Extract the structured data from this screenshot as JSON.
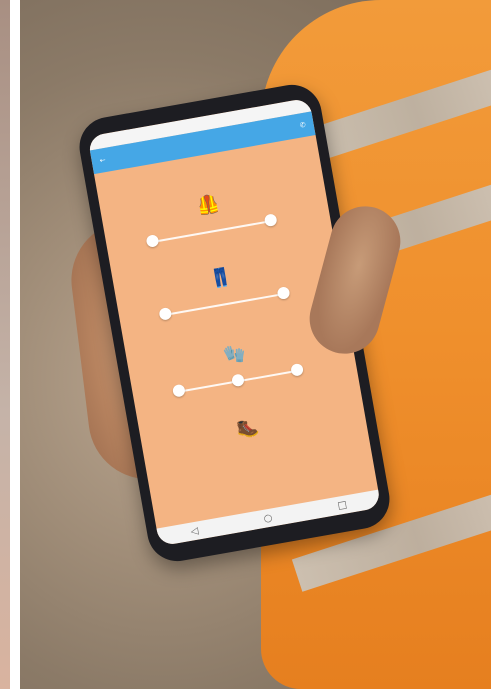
{
  "scene": {
    "description_icons": [
      "safety-vest-icon",
      "work-trousers-icon",
      "work-gloves-icon",
      "safety-boots-icon"
    ],
    "colors": {
      "jacket": "#f09432",
      "background": "#9f8c77",
      "screen": "#f4b483",
      "app_bar": "#45a7e6",
      "phone_body": "#1d1d22"
    }
  },
  "screen": {
    "status_left": "",
    "status_right": "",
    "app_title": "",
    "question": "",
    "items": [
      {
        "name": "vest",
        "icon": "vest-icon"
      },
      {
        "name": "trousers",
        "icon": "trousers-icon"
      },
      {
        "name": "gloves",
        "icon": "gloves-icon"
      },
      {
        "name": "boots",
        "icon": "boots-icon"
      }
    ]
  }
}
